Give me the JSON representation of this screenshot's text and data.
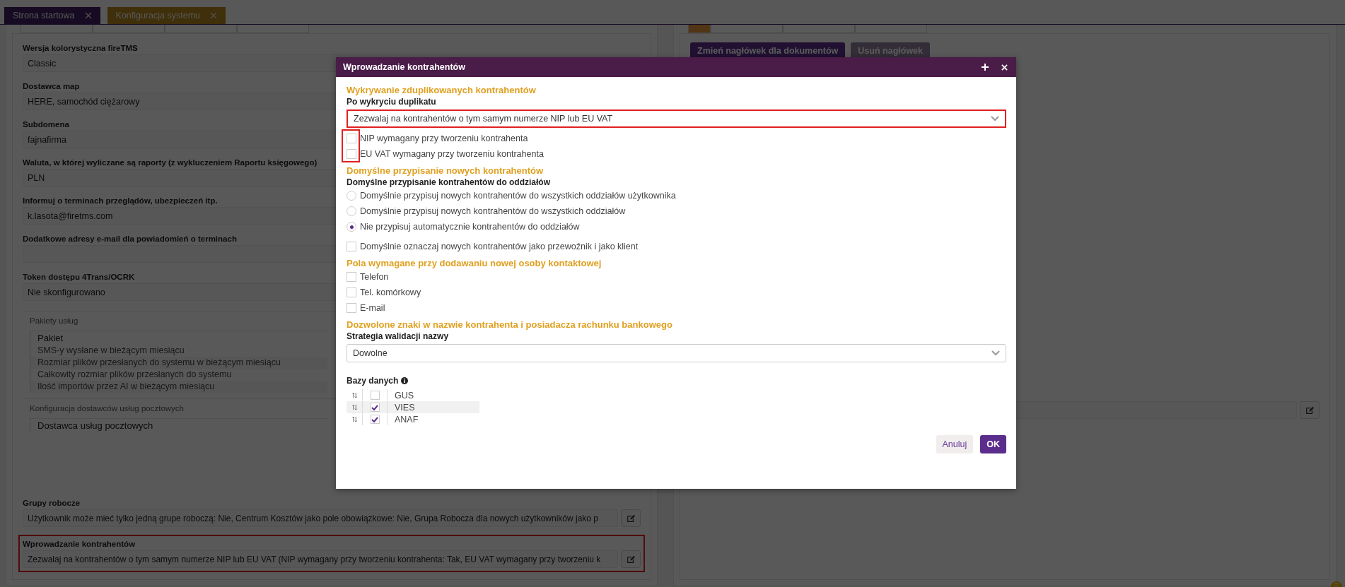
{
  "tabs": [
    {
      "label": "Strona startowa",
      "selected": false
    },
    {
      "label": "Konfiguracja systemu",
      "selected": true
    }
  ],
  "settings": [
    {
      "label": "Wersja kolorystyczna fireTMS",
      "value": "Classic"
    },
    {
      "label": "Dostawca map",
      "value": "HERE, samochód ciężarowy"
    },
    {
      "label": "Subdomena",
      "value": "fajnafirma"
    },
    {
      "label": "Waluta, w której wyliczane są raporty (z wykluczeniem Raportu księgowego)",
      "value": "PLN"
    },
    {
      "label": "Informuj o terminach przeglądów, ubezpieczeń itp.",
      "value": "k.lasota@firetms.com"
    },
    {
      "label": "Dodatkowe adresy e-mail dla powiadomień o terminach"
    },
    {
      "label": "Token dostępu 4Trans/OCRK",
      "value": "Nie skonfigurowano"
    }
  ],
  "service_packages": {
    "legend": "Pakiety usług",
    "header": "Pakiet",
    "rows": [
      "SMS-y wysłane w bieżącym miesiącu",
      "Rozmiar plików przesłanych do systemu w bieżącym miesiącu",
      "Całkowity rozmiar plików przesłanych do systemu",
      "Ilość importów przez AI w bieżącym miesiącu"
    ]
  },
  "postal": {
    "legend": "Konfiguracja dostawców usług pocztowych",
    "header": "Dostawca usług pocztowych"
  },
  "bottom_settings": [
    {
      "label": "Grupy robocze",
      "value": "Użytkownik może mieć tylko jedną grupe roboczą: Nie, Centrum Kosztów jako pole obowiązkowe: Nie, Grupa Robocza dla nowych użytkowników jako p",
      "highlighted": false
    },
    {
      "label": "Wprowadzanie kontrahentów",
      "value": "Zezwalaj na kontrahentów o tym samym numerze NIP lub EU VAT (NIP wymagany przy tworzeniu kontrahenta: Tak, EU VAT wymagany przy tworzeniu k",
      "highlighted": true
    }
  ],
  "right_panel": {
    "buttons": [
      {
        "label": "Zmień nagłówek dla dokumentów",
        "kind": "primary"
      },
      {
        "label": "Usuń nagłówek",
        "kind": "secondary"
      }
    ]
  },
  "dialog": {
    "title": "Wprowadzanie kontrahentów",
    "sections": [
      {
        "title": "Wykrywanie zduplikowanych kontrahentów",
        "items": [
          {
            "kind": "label",
            "text": "Po wykryciu duplikatu"
          },
          {
            "kind": "select",
            "value": "Zezwalaj na kontrahentów o tym samym numerze NIP lub EU VAT",
            "highlighted": true
          },
          {
            "kind": "checkbox_group",
            "highlighted": true,
            "items": [
              {
                "label": "NIP wymagany przy tworzeniu kontrahenta",
                "checked": false
              },
              {
                "label": "EU VAT wymagany przy tworzeniu kontrahenta",
                "checked": false
              }
            ]
          }
        ]
      },
      {
        "title": "Domyślne przypisanie nowych kontrahentów",
        "items": [
          {
            "kind": "label",
            "text": "Domyślne przypisanie kontrahentów do oddziałów"
          },
          {
            "kind": "radio",
            "label": "Domyślnie przypisuj nowych kontrahentów do wszystkich oddziałów użytkownika",
            "selected": false
          },
          {
            "kind": "radio",
            "label": "Domyślnie przypisuj nowych kontrahentów do wszystkich oddziałów",
            "selected": false
          },
          {
            "kind": "radio",
            "label": "Nie przypisuj automatycznie kontrahentów do oddziałów",
            "selected": true
          },
          {
            "kind": "checkbox",
            "label": "Domyślnie oznaczaj nowych kontrahentów jako przewoźnik i jako klient",
            "checked": false
          }
        ]
      },
      {
        "title": "Pola wymagane przy dodawaniu nowej osoby kontaktowej",
        "items": [
          {
            "kind": "checkbox",
            "label": "Telefon",
            "checked": false
          },
          {
            "kind": "checkbox",
            "label": "Tel. komórkowy",
            "checked": false
          },
          {
            "kind": "checkbox",
            "label": "E-mail",
            "checked": false
          }
        ]
      },
      {
        "title": "Dozwolone znaki w nazwie kontrahenta i posiadacza rachunku bankowego",
        "items": [
          {
            "kind": "label",
            "text": "Strategia walidacji nazwy"
          },
          {
            "kind": "select",
            "value": "Dowolne",
            "highlighted": false
          }
        ]
      }
    ],
    "databases": {
      "label": "Bazy danych",
      "rows": [
        {
          "name": "GUS",
          "checked": false,
          "selected": false
        },
        {
          "name": "VIES",
          "checked": true,
          "selected": true
        },
        {
          "name": "ANAF",
          "checked": true,
          "selected": false
        }
      ]
    },
    "buttons": [
      {
        "label": "Anuluj",
        "kind": "secondary"
      },
      {
        "label": "OK",
        "kind": "primary"
      }
    ]
  }
}
